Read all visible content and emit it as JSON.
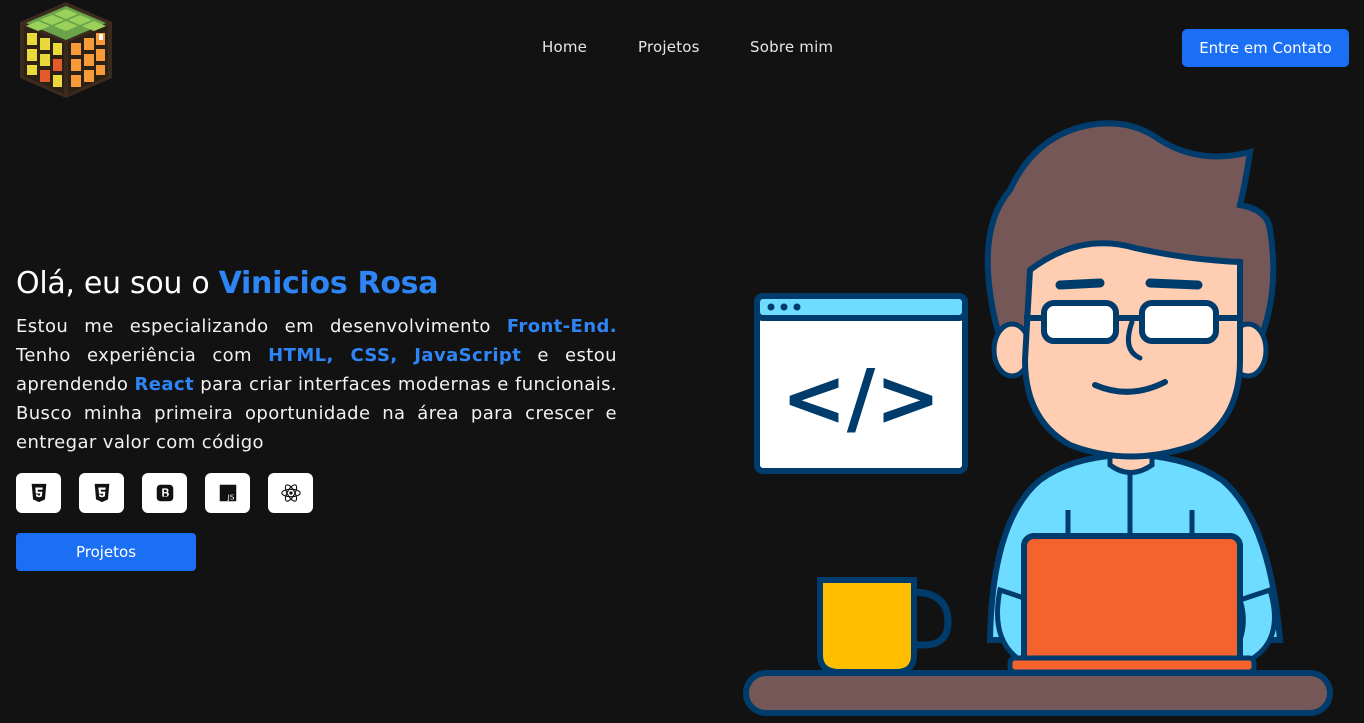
{
  "header": {
    "logo_icon": "rubiks-cube-icon",
    "nav": [
      "Home",
      "Projetos",
      "Sobre mim"
    ],
    "contact_label": "Entre em Contato"
  },
  "hero": {
    "greeting": "Olá, eu sou o ",
    "name": "Vinicios Rosa",
    "p1": "Estou me especializando em desenvolvimento ",
    "h1": "Front-End.",
    "p2": " Tenho experiência com ",
    "h2": "HTML, CSS, JavaScript",
    "p3": " e estou aprendendo ",
    "h3": "React",
    "p4": " para criar interfaces modernas e funcionais. Busco minha primeira oportunidade na área para crescer e entregar valor com código",
    "tech_icons": [
      "html5-icon",
      "css3-icon",
      "bootstrap-icon",
      "javascript-icon",
      "react-icon"
    ],
    "button_label": "Projetos"
  },
  "illustration": {
    "code_glyph": "</>",
    "accent_colors": [
      "#6ddcff",
      "#f4632e",
      "#ffbf00",
      "#755757",
      "#003c6b"
    ]
  }
}
